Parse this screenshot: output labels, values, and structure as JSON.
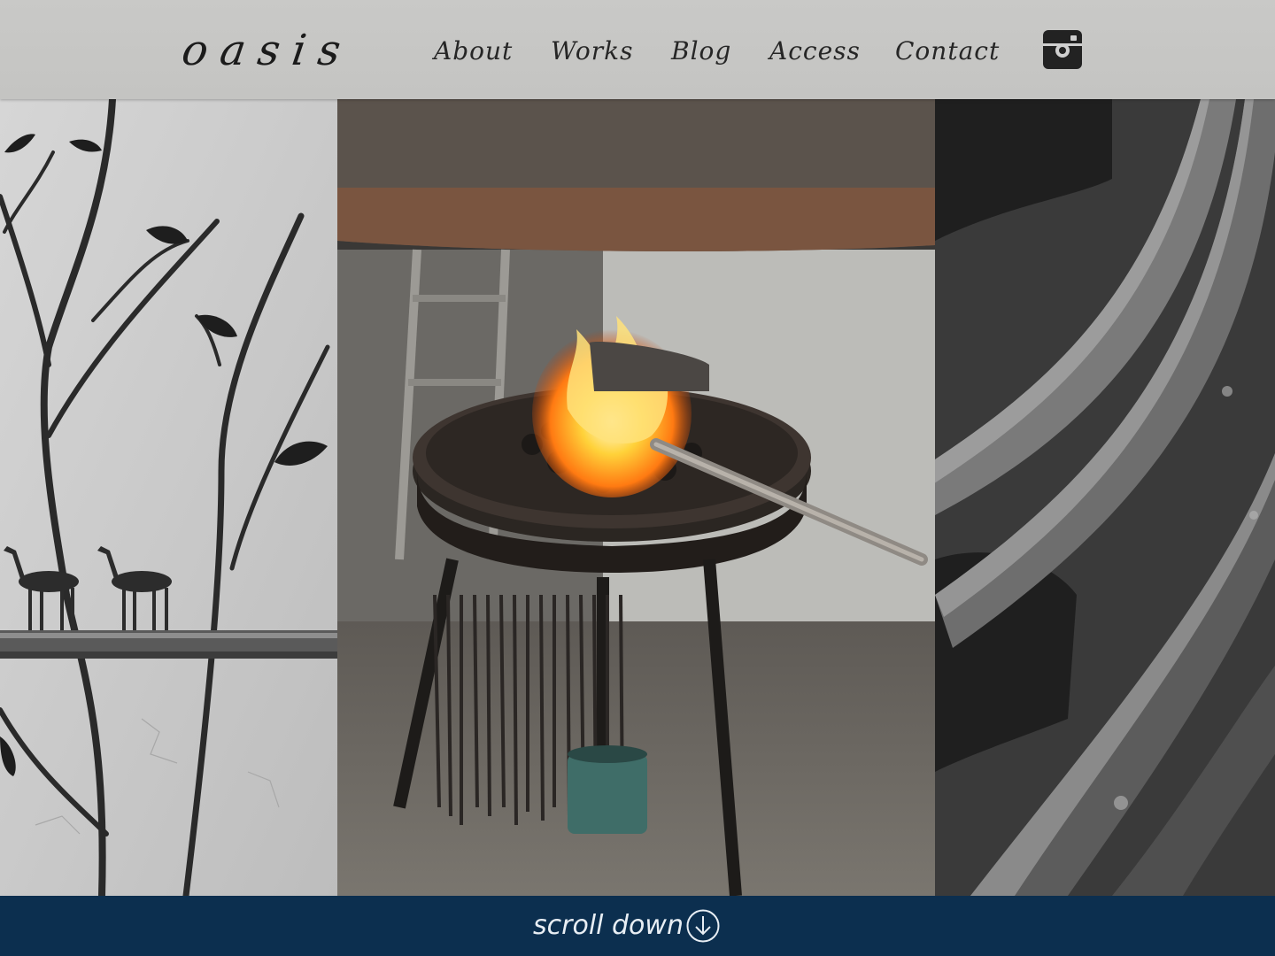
{
  "header": {
    "logo": "oasis",
    "nav": [
      {
        "label": "About"
      },
      {
        "label": "Works"
      },
      {
        "label": "Blog"
      },
      {
        "label": "Access"
      },
      {
        "label": "Contact"
      }
    ],
    "social_icon": "instagram-icon"
  },
  "gallery": {
    "images": [
      {
        "subject": "wrought iron tree with deer",
        "tone": "grayscale"
      },
      {
        "subject": "forge with fire and tongs",
        "tone": "color"
      },
      {
        "subject": "forged iron bars",
        "tone": "grayscale"
      }
    ]
  },
  "footer": {
    "scroll_label": "scroll down",
    "scroll_icon": "arrow-down-circle-icon"
  },
  "colors": {
    "header_bg": "#c7c7c5",
    "footer_bg": "#0c2f4f",
    "text_dark": "#262626",
    "text_light": "#e8eef4"
  }
}
